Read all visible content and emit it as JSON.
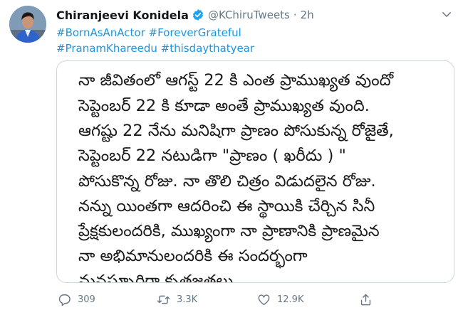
{
  "tweet": {
    "display_name": "Chiranjeevi Konidela",
    "handle": "@KChiruTweets",
    "separator": "·",
    "time": "2h",
    "hashtags_line1": [
      "#BornAsAnActor",
      "#ForeverGrateful"
    ],
    "hashtags_line2": [
      "#PranamKhareedu",
      "#thisdaythatyear"
    ]
  },
  "image_text": {
    "lines": [
      "నా జీవితంలో ఆగస్ట్ 22 కి ఎంత ప్రాముఖ్యత వుందో",
      "సెప్టెంబర్ 22 కి కూడా అంతే ప్రాముఖ్యత వుంది.",
      "ఆగష్టు 22 నేను మనిషిగా ప్రాణం పోసుకున్న రోజైతే,",
      "సెప్టెంబర్ 22 నటుడిగా  \"ప్రాణం ( ఖరీదు ) \"",
      "పోసుకొన్న రోజు. నా తొలి చిత్రం విడుదలైన రోజు.",
      "నన్ను యింతగా ఆదరించి ఈ స్థాయికి చేర్చిన సినీ",
      "ప్రేక్షకులందరికి, ముఖ్యంగా నా ప్రాణానికి ప్రాణమైన",
      "నా అభిమానులందరికి ఈ సందర్భంగా",
      "మనస్పూర్తిగా కృతజ్ఞతలు"
    ]
  },
  "actions": {
    "replies": "309",
    "retweets": "3.3K",
    "likes": "12.9K"
  },
  "icons": {
    "verified": "verified-badge-icon",
    "caret": "chevron-down-icon",
    "reply": "reply-icon",
    "retweet": "retweet-icon",
    "like": "heart-icon",
    "share": "share-icon"
  },
  "colors": {
    "link": "#1b95e0",
    "secondary_text": "#657786",
    "verified": "#1da1f2"
  }
}
